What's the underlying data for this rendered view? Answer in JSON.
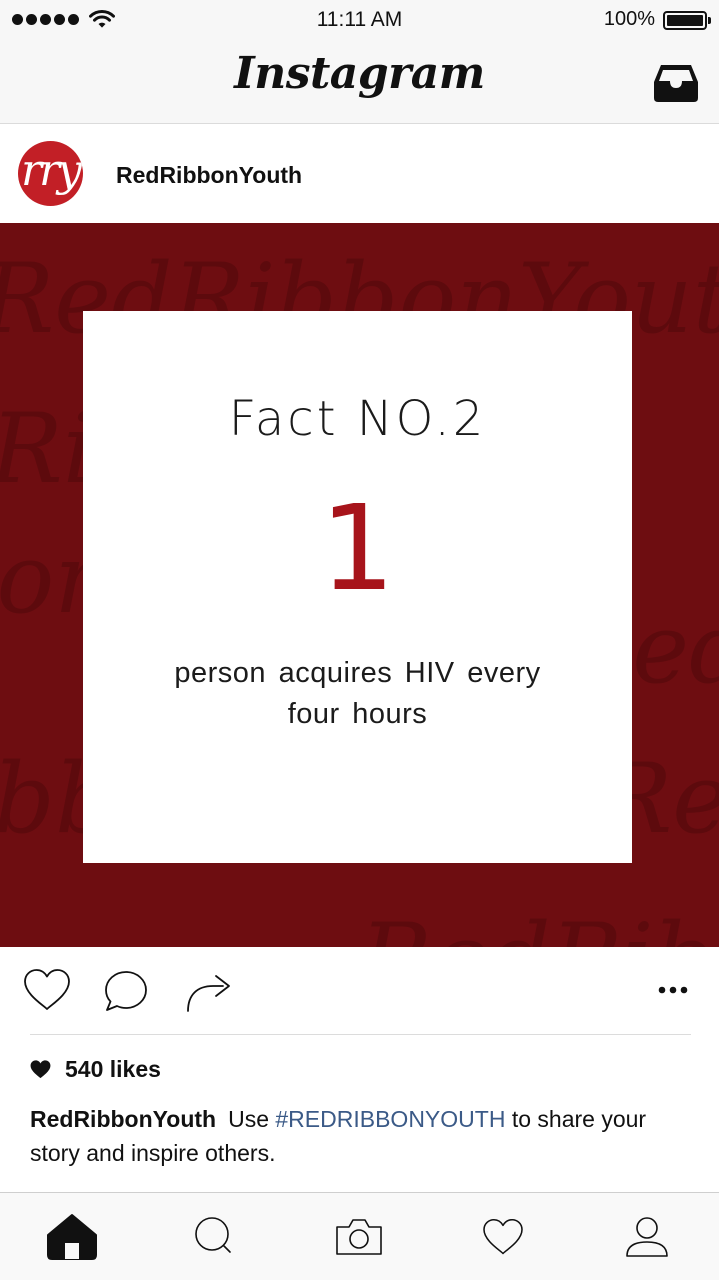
{
  "status_bar": {
    "time": "11:11 AM",
    "battery": "100%",
    "icons": [
      "signal-dots-icon",
      "wifi-icon",
      "battery-icon"
    ]
  },
  "header": {
    "logo": "Instagram",
    "inbox_icon": "inbox-tray-icon"
  },
  "post": {
    "avatar_text": "rry",
    "avatar_color": "#c21f26",
    "username": "RedRibbonYouth",
    "image": {
      "background_color": "#6e0d11",
      "watermark_text": "RedRibbonYouth",
      "fact_title": "Fact NO.2",
      "fact_number": "1",
      "fact_number_color": "#a7141b",
      "fact_text": "person acquires HIV every four hours"
    },
    "actions": [
      "heart-icon",
      "comment-icon",
      "share-icon",
      "more-dots-icon"
    ],
    "likes": "540 likes",
    "caption": {
      "user": "RedRibbonYouth",
      "before": "Use ",
      "hashtag": "#REDRIBBONYOUTH",
      "hashtag_color": "#3b5a87",
      "after": " to share your story and inspire others."
    }
  },
  "bottom_nav": {
    "items": [
      "home-icon",
      "search-icon",
      "camera-icon",
      "activity-heart-icon",
      "profile-icon"
    ],
    "active": "home-icon"
  }
}
